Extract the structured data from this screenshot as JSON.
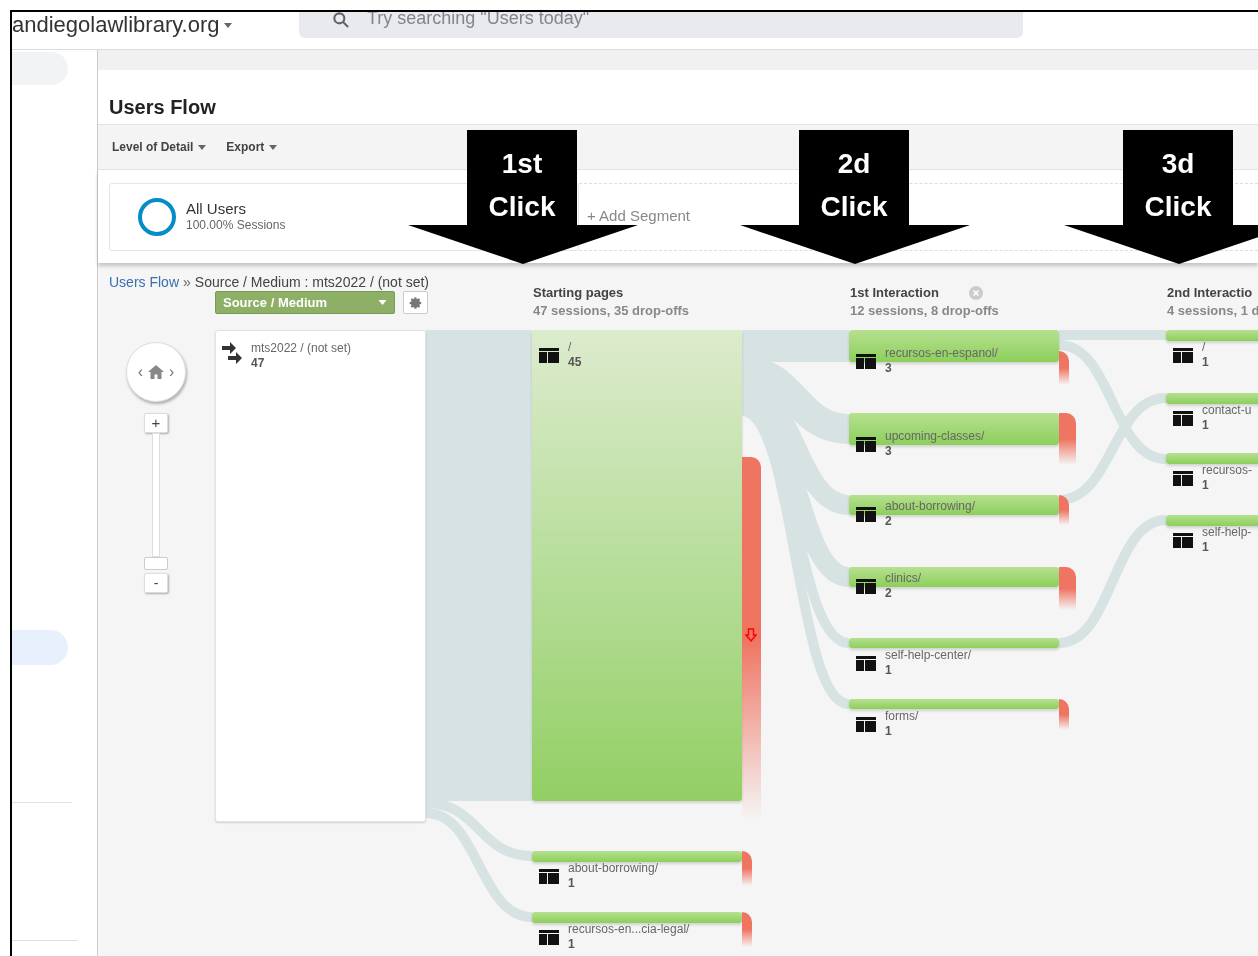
{
  "header": {
    "property": "andiegolawlibrary.org",
    "search_placeholder": "Try searching \"Users today\""
  },
  "report": {
    "title": "Users Flow",
    "toolbar": [
      {
        "label": "Level of Detail"
      },
      {
        "label": "Export"
      }
    ]
  },
  "segment": {
    "name": "All Users",
    "detail": "100.00% Sessions",
    "add_label": "+ Add Segment"
  },
  "breadcrumb": {
    "link": "Users Flow",
    "separator": "»",
    "path": "Source / Medium : mts2022 / (not set)"
  },
  "dimension_select": "Source / Medium",
  "zoom": {
    "left": "‹",
    "right": "›",
    "plus": "+",
    "minus": "-"
  },
  "source_node": {
    "label": "mts2022 / (not set)",
    "count": "47"
  },
  "columns": [
    {
      "title": "Starting pages",
      "summary": "47 sessions, 35 drop-offs",
      "nodes": [
        {
          "label": "/",
          "count": "45"
        },
        {
          "label": "about-borrowing/",
          "count": "1"
        },
        {
          "label": "recursos-en...cia-legal/",
          "count": "1"
        }
      ]
    },
    {
      "title": "1st Interaction",
      "summary": "12 sessions, 8 drop-offs",
      "closable": true,
      "nodes": [
        {
          "label": "recursos-en-espanol/",
          "count": "3"
        },
        {
          "label": "upcoming-classes/",
          "count": "3"
        },
        {
          "label": "about-borrowing/",
          "count": "2"
        },
        {
          "label": "clinics/",
          "count": "2"
        },
        {
          "label": "self-help-center/",
          "count": "1"
        },
        {
          "label": "forms/",
          "count": "1"
        }
      ]
    },
    {
      "title": "2nd Interactio",
      "summary": "4 sessions, 1 d",
      "nodes": [
        {
          "label": "/",
          "count": "1"
        },
        {
          "label": "contact-u",
          "count": "1"
        },
        {
          "label": "recursos-",
          "count": "1"
        },
        {
          "label": "self-help-",
          "count": "1"
        }
      ]
    }
  ],
  "annotations": [
    {
      "line1": "1st",
      "line2": "Click"
    },
    {
      "line1": "2d",
      "line2": "Click"
    },
    {
      "line1": "3d",
      "line2": "Click"
    }
  ]
}
